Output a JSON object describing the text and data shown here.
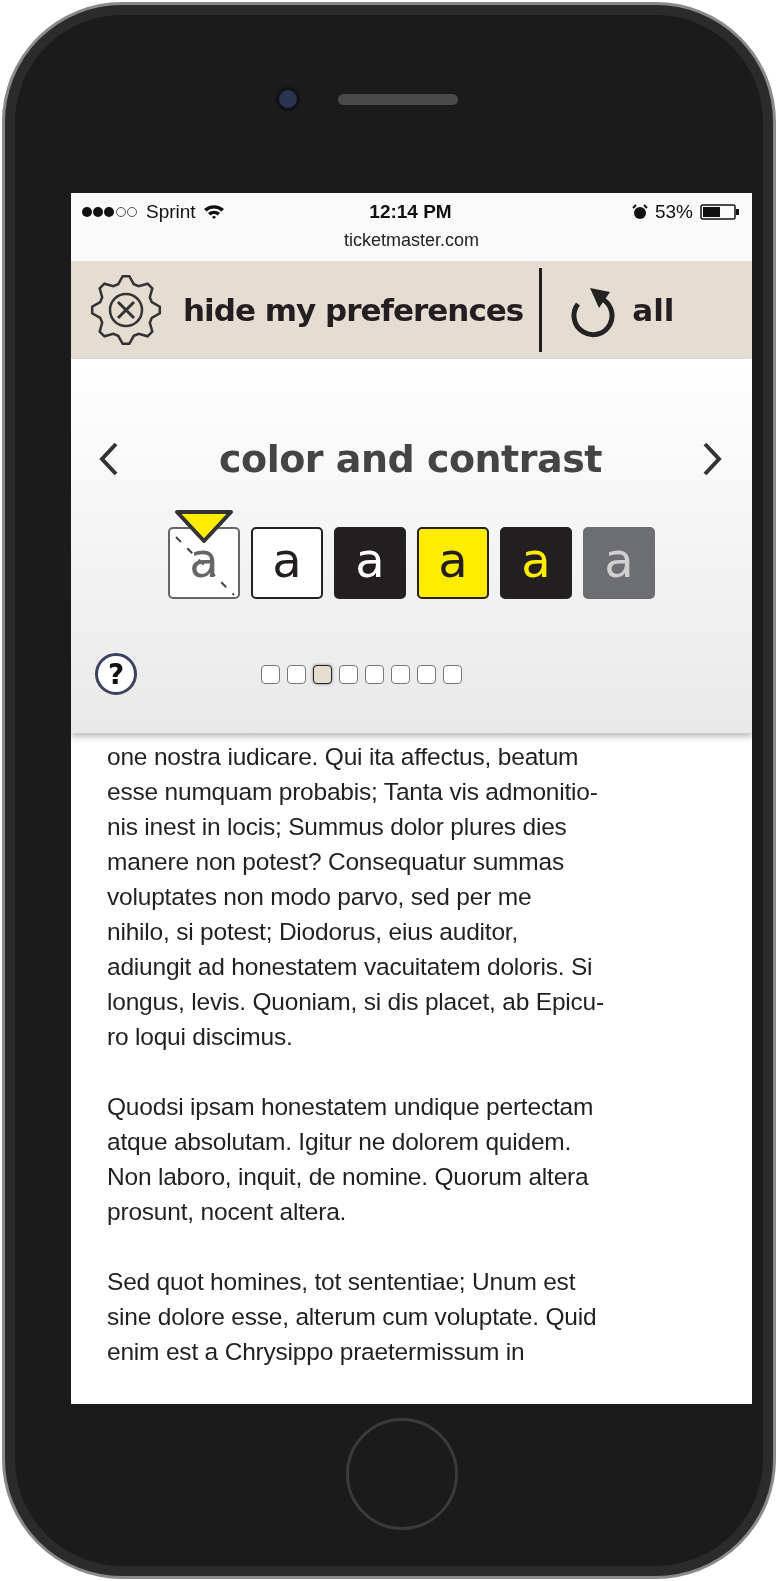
{
  "status_bar": {
    "carrier": "Sprint",
    "time": "12:14 PM",
    "battery": "53%"
  },
  "address_bar": {
    "url": "ticketmaster.com"
  },
  "toolbar": {
    "hide_label": "hide my preferences",
    "reset_label": "all"
  },
  "panel": {
    "title": "color and contrast",
    "swatches": [
      {
        "kind": "none",
        "letter": "a",
        "selected": true
      },
      {
        "kind": "black-on-white",
        "letter": "a",
        "selected": false
      },
      {
        "kind": "white-on-black",
        "letter": "a",
        "selected": false
      },
      {
        "kind": "black-on-yellow",
        "letter": "a",
        "selected": false
      },
      {
        "kind": "yellow-on-black",
        "letter": "a",
        "selected": false
      },
      {
        "kind": "light-on-gray",
        "letter": "a",
        "selected": false
      }
    ],
    "help": "?",
    "pages": [
      {
        "selected": false
      },
      {
        "selected": false
      },
      {
        "selected": true
      },
      {
        "selected": false
      },
      {
        "selected": false
      },
      {
        "selected": false
      },
      {
        "selected": false
      },
      {
        "selected": false
      }
    ]
  },
  "article": {
    "paragraphs": [
      [
        "one nostra iudicare. Qui ita affectus, beatum",
        "esse numquam probabis; Tanta vis admonitio-",
        "nis inest in locis; Summus dolor plures dies",
        "manere non potest? Consequatur summas",
        "voluptates non modo parvo, sed per me",
        "nihilo, si potest; Diodorus, eius auditor,",
        "adiungit ad honestatem vacuitatem doloris. Si",
        "longus, levis. Quoniam, si dis placet, ab Epicu-",
        "ro loqui discimus."
      ],
      [
        "Quodsi ipsam honestatem undique pertectam",
        "atque absolutam. Igitur ne dolorem quidem.",
        "Non laboro, inquit, de nomine. Quorum altera",
        "prosunt, nocent altera."
      ],
      [
        "Sed quot homines, tot sententiae; Unum est",
        "sine dolore esse, alterum cum voluptate. Quid",
        "enim est a Chrysippo praetermissum in"
      ]
    ]
  }
}
